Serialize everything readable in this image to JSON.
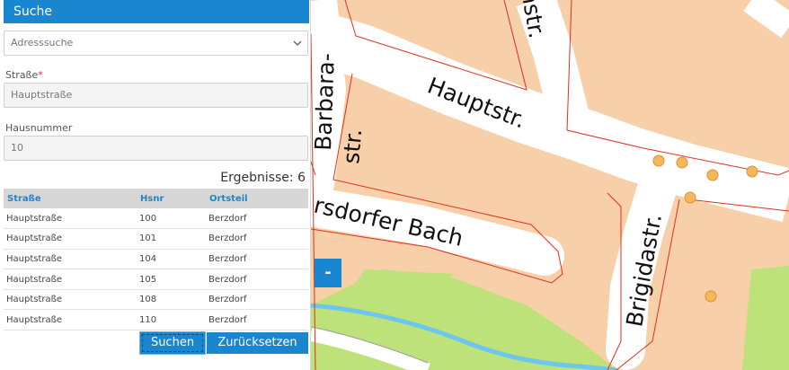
{
  "panel": {
    "title": "Suche",
    "address_search": {
      "placeholder": "Adresssuche",
      "icon": "chevron-down-icon"
    },
    "street": {
      "label": "Straße",
      "required_mark": "*",
      "value": "Hauptstraße"
    },
    "house_number": {
      "label": "Hausnummer",
      "value": "10"
    },
    "results_count": "Ergebnisse: 6",
    "table": {
      "headers": [
        "Straße",
        "Hsnr",
        "Ortsteil"
      ],
      "rows": [
        [
          "Hauptstraße",
          "100",
          "Berzdorf"
        ],
        [
          "Hauptstraße",
          "101",
          "Berzdorf"
        ],
        [
          "Hauptstraße",
          "104",
          "Berzdorf"
        ],
        [
          "Hauptstraße",
          "105",
          "Berzdorf"
        ],
        [
          "Hauptstraße",
          "108",
          "Berzdorf"
        ],
        [
          "Hauptstraße",
          "110",
          "Berzdorf"
        ]
      ]
    },
    "buttons": {
      "search": "Suchen",
      "reset": "Zurücksetzen"
    }
  },
  "map": {
    "zoom_out": "-",
    "labels": {
      "hauptstr": "Hauptstr.",
      "hstr_partial": "hstr.",
      "barbara_line1": "Barbara-",
      "barbara_line2": "str.",
      "bach": "rsdorfer Bach",
      "brigidastr": "Brigidastr."
    },
    "colors": {
      "parcel": "#f7cfa8",
      "road": "#ffffff",
      "green": "#bde27a",
      "water": "#6cc6ee",
      "boundary": "#e0301e",
      "marker": "#f5b75a",
      "accent": "#1a86d0"
    }
  }
}
